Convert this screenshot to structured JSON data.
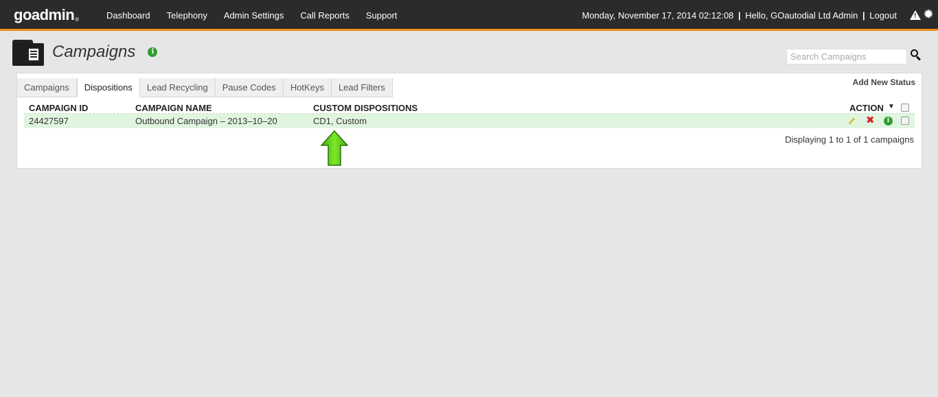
{
  "topbar": {
    "logo": "goadmin",
    "logo_mark": "®",
    "nav": [
      "Dashboard",
      "Telephony",
      "Admin Settings",
      "Call Reports",
      "Support"
    ],
    "datetime": "Monday, November 17, 2014 02:12:08",
    "separator": "|",
    "greeting": "Hello, GOautodial Ltd Admin",
    "logout": "Logout",
    "icons": [
      "warning-icon",
      "gear-icon"
    ]
  },
  "page": {
    "title": "Campaigns",
    "search_placeholder": "Search Campaigns"
  },
  "tabs": [
    {
      "label": "Campaigns",
      "active": false
    },
    {
      "label": "Dispositions",
      "active": true
    },
    {
      "label": "Lead Recycling",
      "active": false
    },
    {
      "label": "Pause Codes",
      "active": false
    },
    {
      "label": "HotKeys",
      "active": false
    },
    {
      "label": "Lead Filters",
      "active": false
    }
  ],
  "add_status": "Add New Status",
  "table": {
    "headers": {
      "campaign_id": "CAMPAIGN ID",
      "campaign_name": "CAMPAIGN NAME",
      "custom_dispositions": "CUSTOM DISPOSITIONS",
      "action": "ACTION",
      "sort_glyph": "▼"
    },
    "rows": [
      {
        "campaign_id": "24427597",
        "campaign_name": "Outbound Campaign – 2013–10–20",
        "custom_dispositions": "CD1, Custom"
      }
    ],
    "footer": "Displaying 1 to 1 of 1 campaigns"
  },
  "colors": {
    "topbar": "#2b2b2b",
    "accent": "#f08c1a",
    "row_highlight": "#e0f5e0",
    "info_green": "#2e9e2e",
    "delete_red": "#d82222",
    "arrow_green": "#5fd11a"
  }
}
